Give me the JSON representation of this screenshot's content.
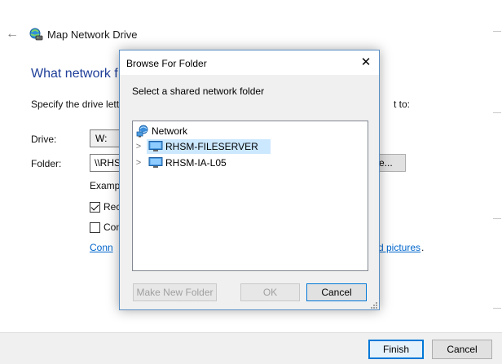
{
  "wizard": {
    "title": "Map Network Drive",
    "heading": "What network f",
    "specify_text": "Specify the drive lett",
    "specify_tail": "t to:",
    "drive_label": "Drive:",
    "drive_value": "W:",
    "folder_label": "Folder:",
    "folder_value": "\\\\RHS",
    "browse_label": "e...",
    "example_text": "Examp",
    "reconnect_label": "Rec",
    "reconnect_checked": true,
    "credentials_label": "Con",
    "credentials_checked": false,
    "connect_link": "Conn",
    "pictures_link": "d pictures",
    "period": ".",
    "finish_label": "Finish",
    "cancel_label": "Cancel"
  },
  "dialog": {
    "title": "Browse For Folder",
    "close_glyph": "✕",
    "description": "Select a shared network folder",
    "tree": {
      "root": "Network",
      "items": [
        {
          "label": "RHSM-FILESERVER",
          "selected": true
        },
        {
          "label": "RHSM-IA-L05",
          "selected": false
        }
      ]
    },
    "new_folder_label": "Make New Folder",
    "ok_label": "OK",
    "cancel_label": "Cancel"
  },
  "icons": {
    "back": "back-arrow-icon",
    "wizard": "network-drive-icon",
    "network": "network-icon",
    "computer": "computer-icon",
    "expand": "chevron-right-icon",
    "close": "close-icon"
  },
  "colors": {
    "heading": "#1f3f99",
    "link": "#0066cc",
    "selection": "#cce8ff",
    "accent": "#0078d7"
  }
}
